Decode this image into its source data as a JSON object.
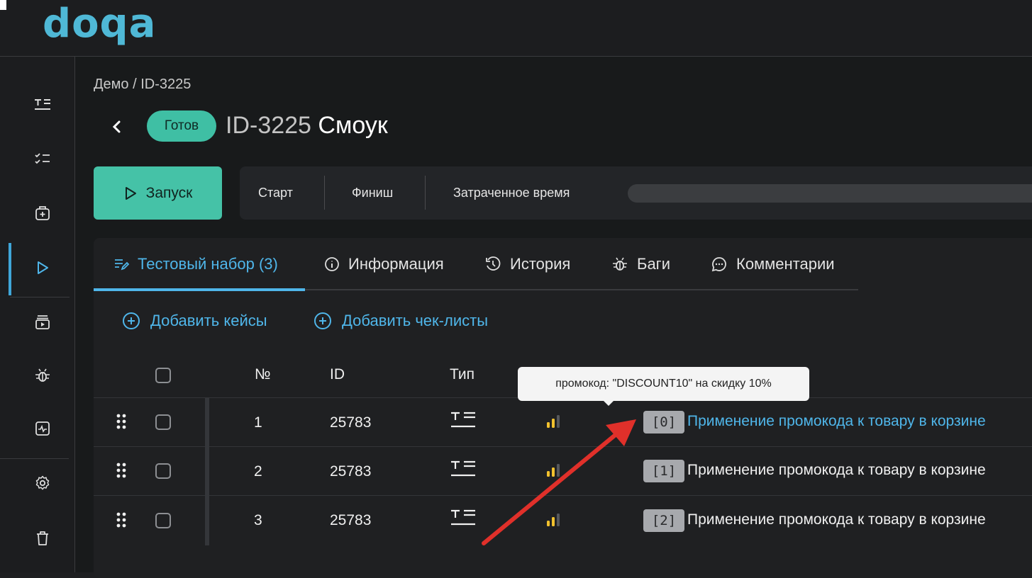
{
  "app": {
    "logo_text": "doqa"
  },
  "colors": {
    "accent": "#4fb6ea",
    "status_ready": "#3fbfa4",
    "run_button": "#45c2a7",
    "annotation_arrow": "#e0302a"
  },
  "sidebar": {
    "items": [
      {
        "icon": "test-cases-icon"
      },
      {
        "icon": "checklists-icon"
      },
      {
        "icon": "add-plan-icon"
      },
      {
        "icon": "runs-icon",
        "active": true
      },
      {
        "icon": "playlist-icon"
      },
      {
        "icon": "bug-icon"
      },
      {
        "icon": "reports-icon"
      },
      {
        "icon": "gear-icon"
      },
      {
        "icon": "trash-icon"
      }
    ]
  },
  "breadcrumb": "Демо / ID-3225",
  "header": {
    "status": "Готов",
    "id": "ID-3225",
    "name": "Смоук"
  },
  "run_button": "Запуск",
  "timing": {
    "start_label": "Старт",
    "finish_label": "Финиш",
    "elapsed_label": "Затраченное время"
  },
  "tabs": [
    {
      "label": "Тестовый набор (3)",
      "icon": "list-edit-icon",
      "active": true
    },
    {
      "label": "Информация",
      "icon": "info-icon"
    },
    {
      "label": "История",
      "icon": "history-icon"
    },
    {
      "label": "Баги",
      "icon": "bug-icon"
    },
    {
      "label": "Комментарии",
      "icon": "comment-icon"
    }
  ],
  "actions": {
    "add_cases": "Добавить кейсы",
    "add_checklists": "Добавить чек-листы"
  },
  "table": {
    "headers": {
      "num": "№",
      "id": "ID",
      "type": "Тип"
    },
    "rows": [
      {
        "num": "1",
        "id": "25783",
        "tag": "[0]",
        "name": "Применение промокода к товару в корзине",
        "hovered": true
      },
      {
        "num": "2",
        "id": "25783",
        "tag": "[1]",
        "name": "Применение промокода к товару в корзине"
      },
      {
        "num": "3",
        "id": "25783",
        "tag": "[2]",
        "name": "Применение промокода к товару в корзине"
      }
    ]
  },
  "tooltip": "промокод: \"DISCOUNT10\" на скидку 10%"
}
